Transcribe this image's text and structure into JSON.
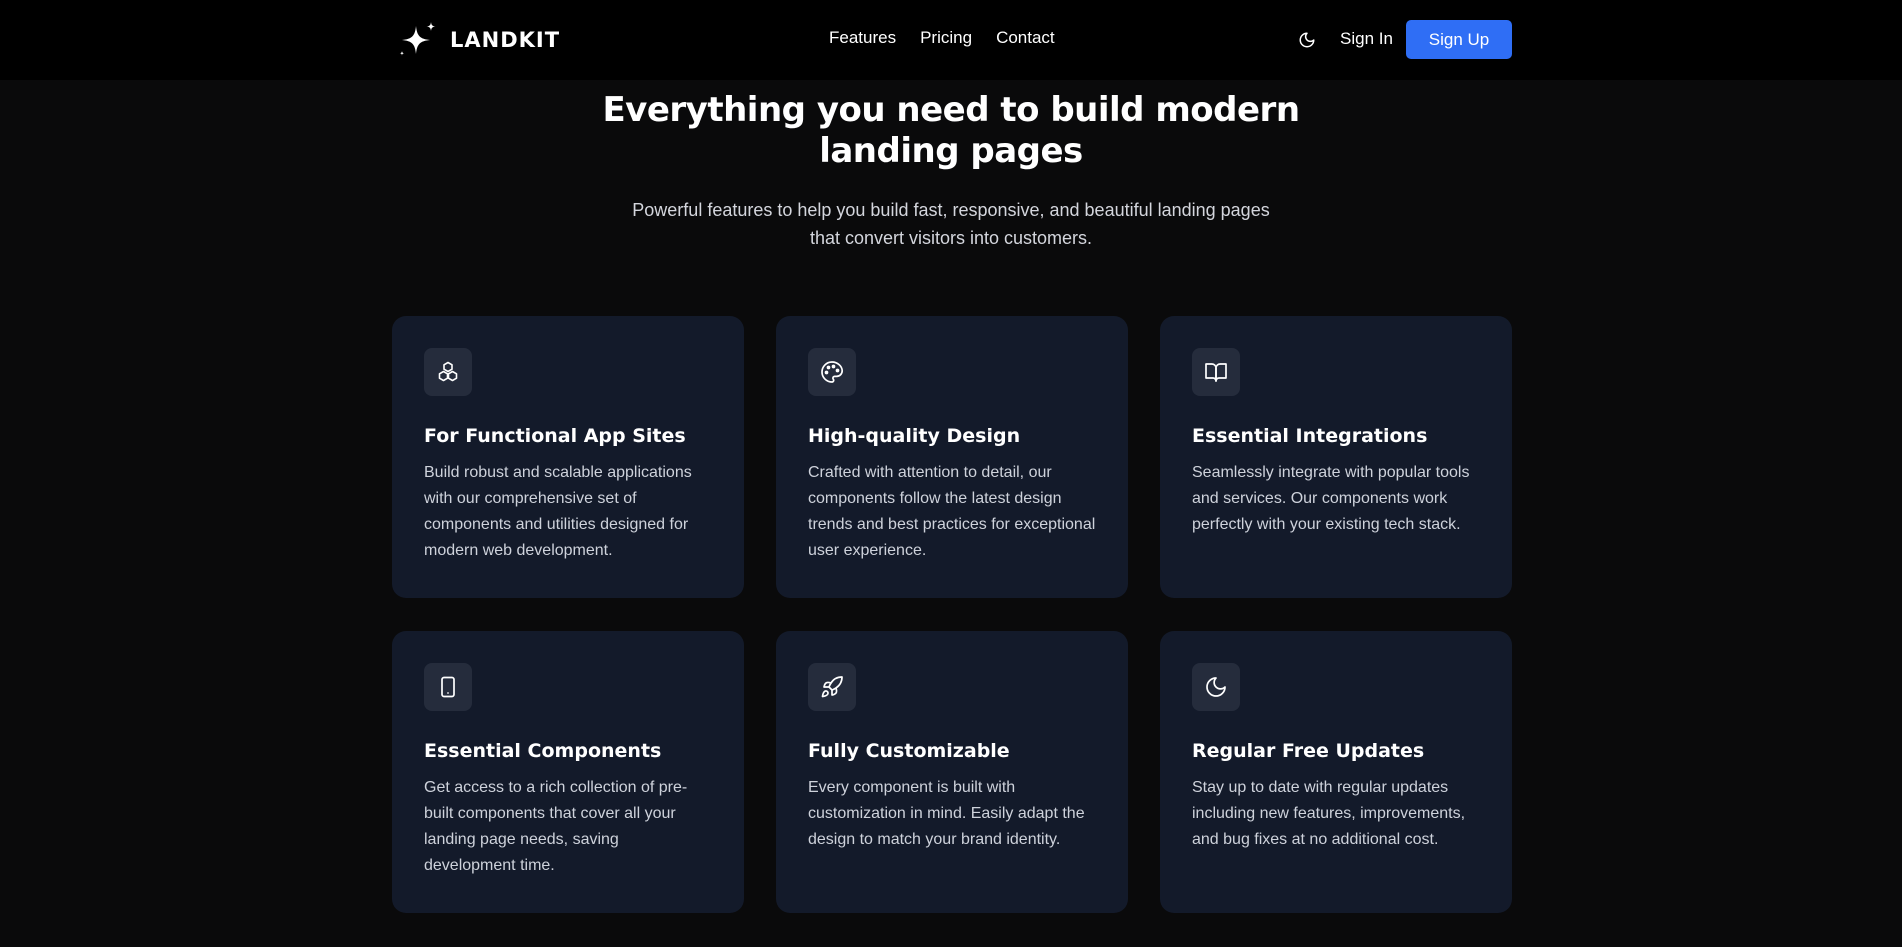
{
  "brand": {
    "name": "LANDKIT"
  },
  "nav": {
    "links": [
      "Features",
      "Pricing",
      "Contact"
    ],
    "sign_in": "Sign In",
    "sign_up": "Sign Up"
  },
  "hero": {
    "title_line1": "Everything you need to build modern",
    "title_line2": "landing pages",
    "subtitle_line1": "Powerful features to help you build fast, responsive, and beautiful landing pages",
    "subtitle_line2": "that convert visitors into customers."
  },
  "features": [
    {
      "icon": "blocks-icon",
      "title": "For Functional App Sites",
      "description": "Build robust and scalable applications with our comprehensive set of components and utilities designed for modern web development."
    },
    {
      "icon": "palette-icon",
      "title": "High-quality Design",
      "description": "Crafted with attention to detail, our components follow the latest design trends and best practices for exceptional user experience."
    },
    {
      "icon": "book-open-icon",
      "title": "Essential Integrations",
      "description": "Seamlessly integrate with popular tools and services. Our components work perfectly with your existing tech stack."
    },
    {
      "icon": "tablet-icon",
      "title": "Essential Components",
      "description": "Get access to a rich collection of pre-built components that cover all your landing page needs, saving development time."
    },
    {
      "icon": "rocket-icon",
      "title": "Fully Customizable",
      "description": "Every component is built with customization in mind. Easily adapt the design to match your brand identity."
    },
    {
      "icon": "moon-icon",
      "title": "Regular Free Updates",
      "description": "Stay up to date with regular updates including new features, improvements, and bug fixes at no additional cost."
    }
  ],
  "colors": {
    "page_background": "#0a0a0b",
    "header_background": "#000000",
    "card_background": "#131a2a",
    "icon_tile": "#252c3c",
    "accent": "#2f6ef5"
  }
}
